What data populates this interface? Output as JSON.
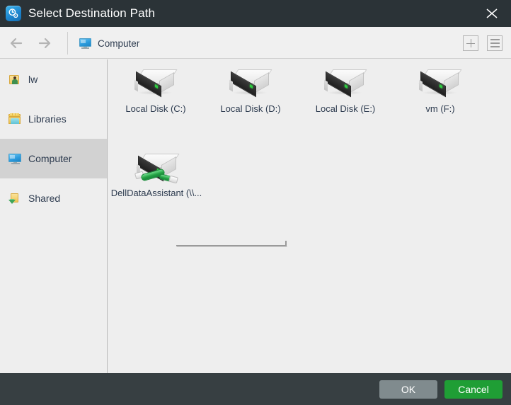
{
  "window": {
    "title": "Select Destination Path",
    "app_icon": "clock-gear-icon",
    "close_icon": "close-icon",
    "titlebar_color": "#2b3337"
  },
  "toolbar": {
    "back_icon": "arrow-left-icon",
    "forward_icon": "arrow-right-icon",
    "breadcrumb": {
      "icon": "computer-monitor-icon",
      "label": "Computer"
    },
    "add_button_icon": "plus-icon",
    "view_button_icon": "list-view-icon"
  },
  "sidebar": {
    "items": [
      {
        "label": "lw",
        "icon": "user-folder-icon",
        "selected": false
      },
      {
        "label": "Libraries",
        "icon": "libraries-folder-icon",
        "selected": false
      },
      {
        "label": "Computer",
        "icon": "computer-monitor-icon",
        "selected": true
      },
      {
        "label": "Shared",
        "icon": "shared-folder-icon",
        "selected": false
      }
    ]
  },
  "content": {
    "items": [
      {
        "label": "Local Disk (C:)",
        "icon": "hard-drive-icon",
        "type": "local"
      },
      {
        "label": "Local Disk (D:)",
        "icon": "hard-drive-icon",
        "type": "local"
      },
      {
        "label": "Local Disk (E:)",
        "icon": "hard-drive-icon",
        "type": "local"
      },
      {
        "label": "vm (F:)",
        "icon": "hard-drive-icon",
        "type": "local"
      },
      {
        "label": "DellDataAssistant (\\\\...",
        "icon": "network-drive-icon",
        "type": "network"
      }
    ],
    "scrollbar": "horizontal-scrollbar"
  },
  "footer": {
    "ok_label": "OK",
    "cancel_label": "Cancel",
    "ok_color": "#808b8e",
    "cancel_color": "#1f9e35",
    "bar_color": "#373f42"
  }
}
